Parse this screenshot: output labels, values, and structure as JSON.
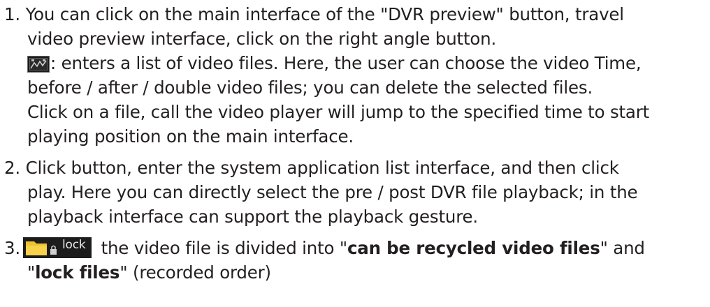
{
  "items": [
    {
      "number": "1.",
      "lines": [
        "You can click on the main interface of the \"DVR preview\" button, travel",
        "video preview interface, click on the right angle button.",
        ": enters a list of video files. Here, the user can choose the video Time,",
        "before / after / double video files; you can delete the selected files.",
        "Click on a file, call the video player will jump to the specified time to start",
        "playing position on the main interface."
      ],
      "icon": "video-list-icon"
    },
    {
      "number": "2.",
      "lines": [
        "Click button, enter the system application list interface, and then click",
        "play. Here you can directly select the pre / post DVR file playback; in the",
        "playback interface can support the playback gesture."
      ]
    },
    {
      "number": "3.",
      "icon": "folder-lock-icon",
      "icon_text": "lock",
      "line1_text": " the video file is divided into \"",
      "line1_bold": "can be recycled video files",
      "line1_end": "\" and",
      "line2_start": "\"",
      "line2_bold": "lock files",
      "line2_end": "\" (recorded order)"
    }
  ],
  "colors": {
    "text": "#231f20",
    "folder": "#f0c230"
  }
}
